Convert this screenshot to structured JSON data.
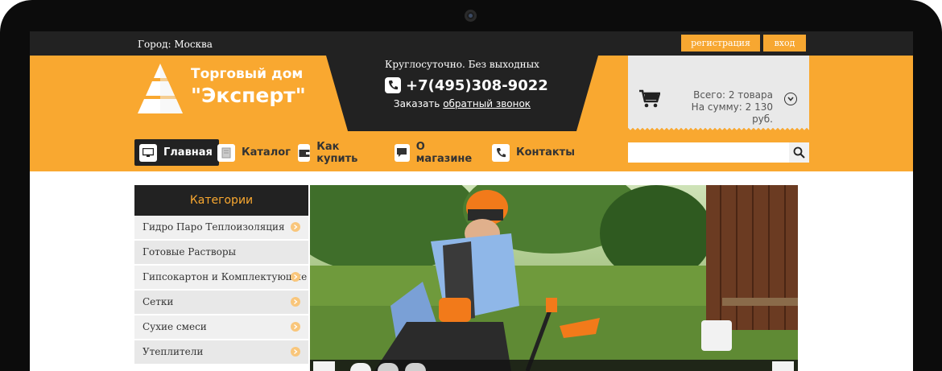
{
  "topbar": {
    "city": "Город: Москва",
    "register": "регистрация",
    "login": "вход"
  },
  "logo": {
    "line1": "Торговый дом",
    "line2": "\"Эксперт\""
  },
  "contact": {
    "hours": "Круглосуточно. Без выходных",
    "phone": "+7(495)308-9022",
    "callback_prefix": "Заказать ",
    "callback_link": "обратный звонок"
  },
  "cart": {
    "total_label": "Всего: ",
    "total_value": "2 товара",
    "sum_label": "На сумму: ",
    "sum_value": "2 130 руб."
  },
  "nav": [
    {
      "label": "Главная",
      "icon": "monitor-icon",
      "active": true
    },
    {
      "label": "Каталог",
      "icon": "catalog-icon",
      "active": false
    },
    {
      "label": "Как купить",
      "icon": "wallet-icon",
      "active": false
    },
    {
      "label": "О магазине",
      "icon": "chat-icon",
      "active": false
    },
    {
      "label": "Контакты",
      "icon": "phone-icon",
      "active": false
    }
  ],
  "search": {
    "placeholder": ""
  },
  "categories": {
    "title": "Категории",
    "items": [
      {
        "label": "Гидро Паро Теплоизоляция",
        "has_arrow": true
      },
      {
        "label": "Готовые Растворы",
        "has_arrow": false
      },
      {
        "label": "Гипсокартон и Комплектующие",
        "has_arrow": true
      },
      {
        "label": "Сетки",
        "has_arrow": true
      },
      {
        "label": "Сухие смеси",
        "has_arrow": true
      },
      {
        "label": "Утеплители",
        "has_arrow": true
      }
    ]
  },
  "colors": {
    "accent": "#f9a830",
    "dark": "#222222"
  }
}
